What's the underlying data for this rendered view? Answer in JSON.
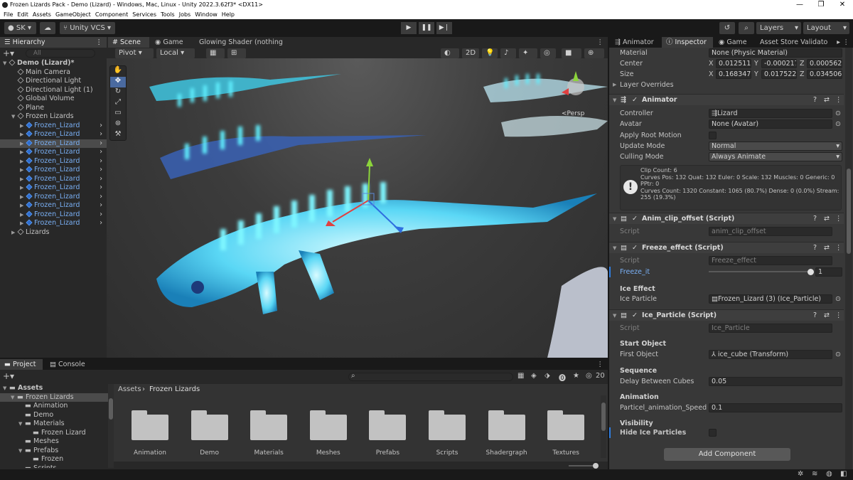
{
  "window": {
    "title": "Frozen Lizards Pack - Demo (Lizard) - Windows, Mac, Linux - Unity 2022.3.62f3* <DX11>",
    "minimize": "—",
    "maximize": "❐",
    "close": "✕"
  },
  "menu": [
    "File",
    "Edit",
    "Assets",
    "GameObject",
    "Component",
    "Services",
    "Tools",
    "Jobs",
    "Window",
    "Help"
  ],
  "toolbar": {
    "account": "SK",
    "vcs": "Unity VCS",
    "layers": "Layers",
    "layout": "Layout"
  },
  "hierarchy": {
    "tab": "Hierarchy",
    "search_placeholder": "All",
    "items": [
      {
        "label": "Demo (Lizard)*",
        "depth": 0,
        "arrow": "▼",
        "bold": true
      },
      {
        "label": "Main Camera",
        "depth": 1
      },
      {
        "label": "Directional Light",
        "depth": 1
      },
      {
        "label": "Directional Light (1)",
        "depth": 1
      },
      {
        "label": "Global Volume",
        "depth": 1
      },
      {
        "label": "Plane",
        "depth": 1
      },
      {
        "label": "Frozen Lizards",
        "depth": 1,
        "arrow": "▼"
      },
      {
        "label": "Frozen_Lizard",
        "depth": 2,
        "arrow": "▶",
        "blue": true
      },
      {
        "label": "Frozen_Lizard",
        "depth": 2,
        "arrow": "▶",
        "blue": true
      },
      {
        "label": "Frozen_Lizard",
        "depth": 2,
        "arrow": "▶",
        "blue": true,
        "selected": true
      },
      {
        "label": "Frozen_Lizard",
        "depth": 2,
        "arrow": "▶",
        "blue": true
      },
      {
        "label": "Frozen_Lizard",
        "depth": 2,
        "arrow": "▶",
        "blue": true
      },
      {
        "label": "Frozen_Lizard",
        "depth": 2,
        "arrow": "▶",
        "blue": true
      },
      {
        "label": "Frozen_Lizard",
        "depth": 2,
        "arrow": "▶",
        "blue": true
      },
      {
        "label": "Frozen_Lizard",
        "depth": 2,
        "arrow": "▶",
        "blue": true
      },
      {
        "label": "Frozen_Lizard",
        "depth": 2,
        "arrow": "▶",
        "blue": true
      },
      {
        "label": "Frozen_Lizard",
        "depth": 2,
        "arrow": "▶",
        "blue": true
      },
      {
        "label": "Frozen_Lizard",
        "depth": 2,
        "arrow": "▶",
        "blue": true
      },
      {
        "label": "Frozen_Lizard",
        "depth": 2,
        "arrow": "▶",
        "blue": true
      },
      {
        "label": "Lizards",
        "depth": 1,
        "arrow": "▶"
      }
    ]
  },
  "scene": {
    "tabs": [
      "Scene",
      "Game",
      "Glowing Shader (nothing l..."
    ],
    "pivot": "Pivot",
    "local": "Local",
    "mode2d": "2D",
    "persp": "<Persp"
  },
  "inspector": {
    "tabs": [
      "Animator",
      "Inspector",
      "Game",
      "Asset Store Validato"
    ],
    "collider": {
      "material_label": "Material",
      "material_value": "None (Physic Material)",
      "center_label": "Center",
      "center": [
        "0.0125116",
        "-0.000217",
        "0.000562"
      ],
      "size_label": "Size",
      "size": [
        "0.1683471",
        "0.0175227",
        "0.034506"
      ],
      "axis": [
        "X",
        "Y",
        "Z"
      ],
      "layer_overrides": "Layer Overrides"
    },
    "animator": {
      "title": "Animator",
      "controller_label": "Controller",
      "controller": "Lizard",
      "avatar_label": "Avatar",
      "avatar": "None (Avatar)",
      "root_motion_label": "Apply Root Motion",
      "update_mode_label": "Update Mode",
      "update_mode": "Normal",
      "culling_mode_label": "Culling Mode",
      "culling_mode": "Always Animate",
      "info_lines": [
        "Clip Count: 6",
        "Curves Pos: 132 Quat: 132 Euler: 0 Scale: 132 Muscles: 0 Generic: 0",
        "PPtr: 0",
        "Curves Count: 1320 Constant: 1065 (80.7%) Dense: 0 (0.0%) Stream:",
        "255 (19.3%)"
      ]
    },
    "anim_clip": {
      "title": "Anim_clip_offset (Script)",
      "script_label": "Script",
      "script": "anim_clip_offset"
    },
    "freeze": {
      "title": "Freeze_effect (Script)",
      "script_label": "Script",
      "script": "Freeze_effect",
      "freeze_label": "Freeze_it",
      "freeze_value": "1",
      "section": "Ice Effect",
      "particle_label": "Ice Particle",
      "particle": "Frozen_Lizard (3) (Ice_Particle)"
    },
    "ice_particle": {
      "title": "Ice_Particle (Script)",
      "script_label": "Script",
      "script": "Ice_Particle",
      "start_section": "Start Object",
      "first_label": "First Object",
      "first": "ice_cube (Transform)",
      "sequence_section": "Sequence",
      "delay_label": "Delay Between Cubes",
      "delay": "0.05",
      "animation_section": "Animation",
      "speed_label": "Particel_animation_Speed",
      "speed": "0.1",
      "visibility_section": "Visibility",
      "hide_label": "Hide Ice Particles"
    },
    "add_component": "Add Component"
  },
  "project": {
    "tabs": [
      "Project",
      "Console"
    ],
    "tree": [
      {
        "label": "Assets",
        "depth": 0,
        "arrow": "▼",
        "bold": true
      },
      {
        "label": "Frozen Lizards",
        "depth": 1,
        "arrow": "▼",
        "selected": true
      },
      {
        "label": "Animation",
        "depth": 2
      },
      {
        "label": "Demo",
        "depth": 2
      },
      {
        "label": "Materials",
        "depth": 2,
        "arrow": "▼"
      },
      {
        "label": "Frozen Lizard",
        "depth": 3
      },
      {
        "label": "Meshes",
        "depth": 2
      },
      {
        "label": "Prefabs",
        "depth": 2,
        "arrow": "▼"
      },
      {
        "label": "Frozen",
        "depth": 3
      },
      {
        "label": "Scripts",
        "depth": 2
      }
    ],
    "breadcrumb": [
      "Assets",
      "Frozen Lizards"
    ],
    "hidden_count": "20",
    "folders": [
      "Animation",
      "Demo",
      "Materials",
      "Meshes",
      "Prefabs",
      "Scripts",
      "Shadergraph",
      "Textures"
    ]
  }
}
